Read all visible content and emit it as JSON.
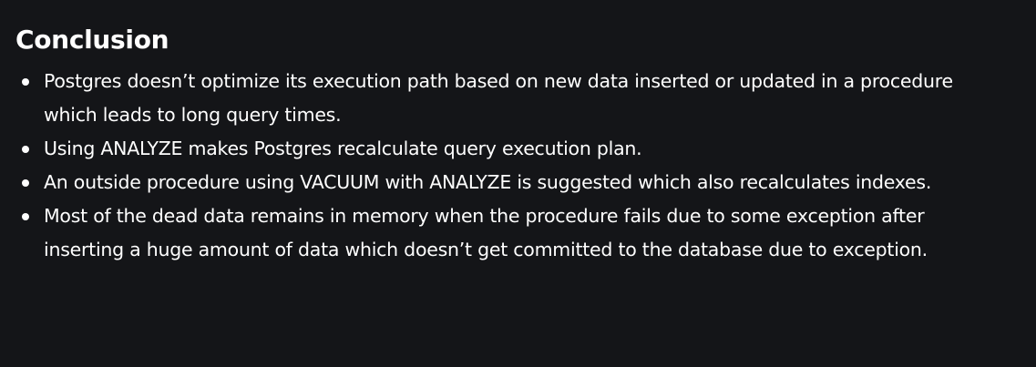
{
  "section": {
    "heading": "Conclusion",
    "bullets": [
      {
        "text": "Postgres doesn’t optimize its execution path based on new data inserted or updated in a procedure which leads to long query times."
      },
      {
        "text": "Using ANALYZE makes Postgres recalculate query execution plan."
      },
      {
        "text": "An outside procedure using VACUUM with ANALYZE is suggested which also recalculates indexes."
      },
      {
        "text": "Most of the dead data remains in memory when the procedure fails due to some exception after inserting a huge amount of data which doesn’t get committed to the database due to exception."
      }
    ]
  }
}
